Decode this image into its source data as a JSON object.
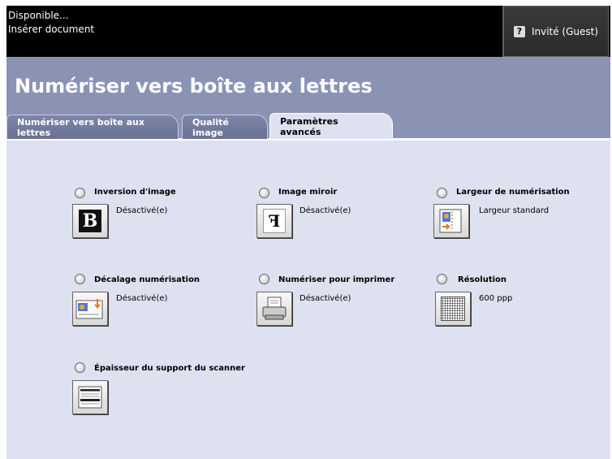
{
  "status": {
    "line1": "Disponible...",
    "line2": "Insérer document"
  },
  "user": {
    "label": "Invité (Guest)"
  },
  "page": {
    "title": "Numériser vers boîte aux lettres"
  },
  "tabs": [
    {
      "label": "Numériser vers boîte aux lettres"
    },
    {
      "label": "Qualité image"
    },
    {
      "label": "Paramètres avancés"
    }
  ],
  "options": {
    "inversion": {
      "label": "Inversion d'image",
      "value": "Désactivé(e)",
      "icon": "b-icon"
    },
    "mirror": {
      "label": "Image miroir",
      "value": "Désactivé(e)",
      "icon": "mirror-icon"
    },
    "width": {
      "label": "Largeur de numérisation",
      "value": "Largeur standard",
      "icon": "scan-width-icon"
    },
    "shift": {
      "label": "Décalage numérisation",
      "value": "Désactivé(e)",
      "icon": "scan-shift-icon"
    },
    "print": {
      "label": "Numériser pour imprimer",
      "value": "Désactivé(e)",
      "icon": "printer-icon"
    },
    "resolution": {
      "label": "Résolution",
      "value": "600 ppp",
      "icon": "resolution-grid-icon"
    },
    "thickness": {
      "label": "Épaisseur du support du scanner",
      "value": "",
      "icon": "media-thickness-icon"
    }
  },
  "colors": {
    "header": "#8b93b5",
    "panel": "#dde1f0",
    "topbar": "#000000"
  }
}
